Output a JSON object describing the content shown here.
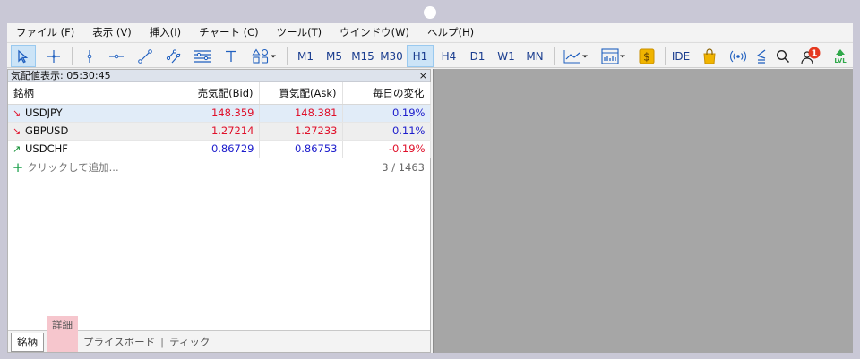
{
  "menu": [
    "ファイル (F)",
    "表示 (V)",
    "挿入(I)",
    "チャート (C)",
    "ツール(T)",
    "ウインドウ(W)",
    "ヘルプ(H)"
  ],
  "toolbar": {
    "timeframes": [
      "M1",
      "M5",
      "M15",
      "M30",
      "H1",
      "H4",
      "D1",
      "W1",
      "MN"
    ],
    "active_timeframe": "H1",
    "ide_label": "IDE",
    "notification_count": "1",
    "lvl_label": "LVL"
  },
  "panel": {
    "title": "気配値表示: 05:30:45",
    "close": "×",
    "columns": [
      "銘柄",
      "売気配(Bid)",
      "買気配(Ask)",
      "毎日の変化"
    ],
    "rows": [
      {
        "arrow": "↘",
        "symbol": "USDJPY",
        "bid": "148.359",
        "ask": "148.381",
        "change": "0.19%"
      },
      {
        "arrow": "↘",
        "symbol": "GBPUSD",
        "bid": "1.27214",
        "ask": "1.27233",
        "change": "0.11%"
      },
      {
        "arrow": "↗",
        "symbol": "USDCHF",
        "bid": "0.86729",
        "ask": "0.86753",
        "change": "-0.19%"
      }
    ],
    "add_label": "クリックして追加...",
    "add_plus": "+",
    "count": "3 / 1463",
    "tabs": [
      "銘柄",
      "詳細",
      "プライスボード",
      "ティック"
    ],
    "tab_separator": "|"
  },
  "colors": {
    "bid_red": "#e0102a",
    "quote_blue": "#1c1ccc",
    "highlight": "#f6c6cd",
    "chart_bg": "#a6a6a6"
  }
}
